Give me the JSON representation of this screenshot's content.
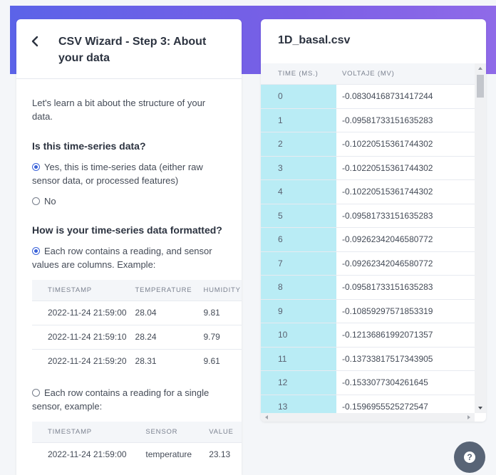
{
  "wizard": {
    "title": "CSV Wizard - Step 3: About your data",
    "intro": "Let's learn a bit about the structure of your data.",
    "q1": "Is this time-series data?",
    "q1_options": [
      {
        "label": "Yes, this is time-series data (either raw sensor data, or processed features)",
        "selected": true
      },
      {
        "label": "No",
        "selected": false
      }
    ],
    "q2": "How is your time-series data formatted?",
    "q2_options": [
      {
        "label": "Each row contains a reading, and sensor values are columns. Example:",
        "selected": true
      },
      {
        "label": "Each row contains a reading for a single sensor, example:",
        "selected": false
      }
    ],
    "example1": {
      "headers": [
        "TIMESTAMP",
        "TEMPERATURE",
        "HUMIDITY"
      ],
      "rows": [
        [
          "2022-11-24 21:59:00",
          "28.04",
          "9.81"
        ],
        [
          "2022-11-24 21:59:10",
          "28.24",
          "9.79"
        ],
        [
          "2022-11-24 21:59:20",
          "28.31",
          "9.61"
        ]
      ]
    },
    "example2": {
      "headers": [
        "TIMESTAMP",
        "SENSOR",
        "VALUE"
      ],
      "rows": [
        [
          "2022-11-24 21:59:00",
          "temperature",
          "23.13"
        ]
      ]
    }
  },
  "file_preview": {
    "filename": "1D_basal.csv",
    "headers": [
      "TIME (MS.)",
      "VOLTAJE (MV)"
    ],
    "rows": [
      [
        "0",
        "-0.08304168731417244"
      ],
      [
        "1",
        "-0.09581733151635283"
      ],
      [
        "2",
        "-0.10220515361744302"
      ],
      [
        "3",
        "-0.10220515361744302"
      ],
      [
        "4",
        "-0.10220515361744302"
      ],
      [
        "5",
        "-0.09581733151635283"
      ],
      [
        "6",
        "-0.09262342046580772"
      ],
      [
        "7",
        "-0.09262342046580772"
      ],
      [
        "8",
        "-0.09581733151635283"
      ],
      [
        "9",
        "-0.10859297571853319"
      ],
      [
        "10",
        "-0.12136861992071357"
      ],
      [
        "11",
        "-0.13733817517343905"
      ],
      [
        "12",
        "-0.1533077304261645"
      ],
      [
        "13",
        "-0.1596955525272547"
      ]
    ]
  },
  "help": {
    "icon": "help-icon",
    "glyph": "?"
  },
  "colors": {
    "accent": "#3b63d9",
    "banner": "#6a61e7",
    "time_column": "#b9ecf5"
  }
}
